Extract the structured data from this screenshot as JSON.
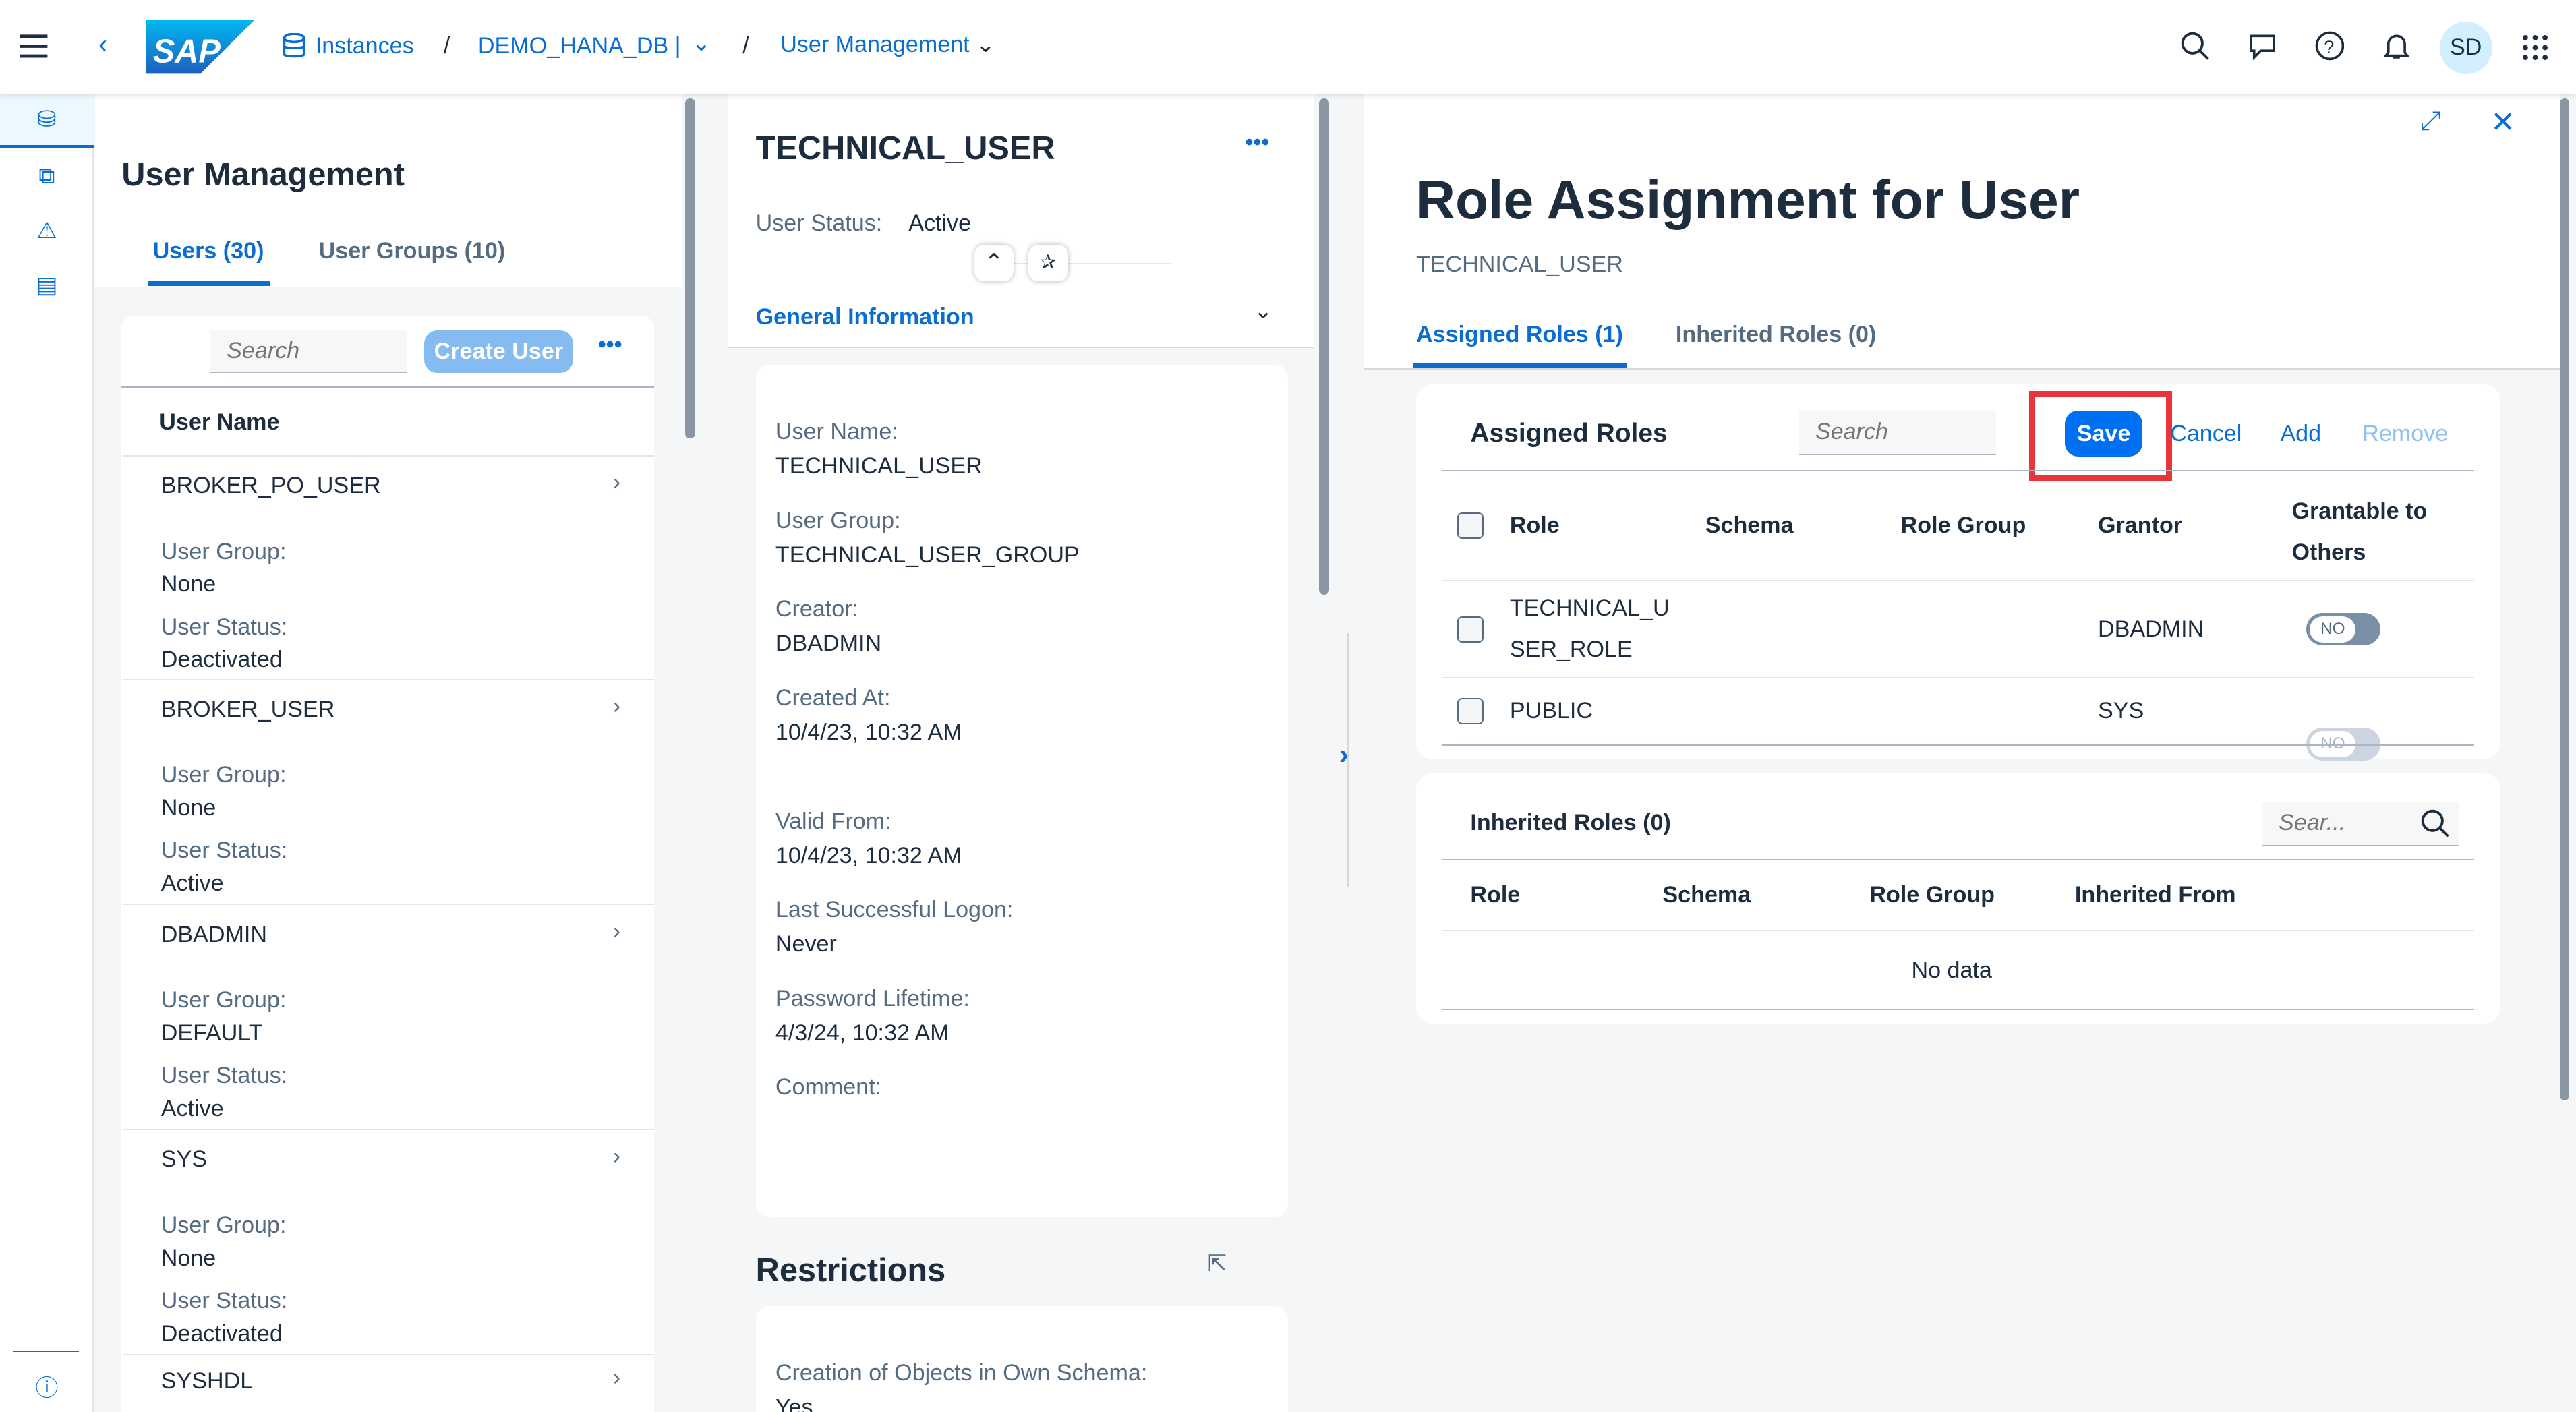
{
  "header": {
    "instances": "Instances",
    "sep": "/",
    "db": "DEMO_HANA_DB |",
    "page": "User Management",
    "avatar": "SD",
    "logo": "SAP"
  },
  "users_panel": {
    "title": "User Management",
    "tabs": [
      "Users (30)",
      "User Groups (10)"
    ],
    "search_placeholder": "Search",
    "create_user": "Create User",
    "column": "User Name",
    "group_label": "User Group:",
    "status_label": "User Status:",
    "users": [
      {
        "name": "BROKER_PO_USER",
        "group": "None",
        "status": "Deactivated"
      },
      {
        "name": "BROKER_USER",
        "group": "None",
        "status": "Active"
      },
      {
        "name": "DBADMIN",
        "group": "DEFAULT",
        "status": "Active"
      },
      {
        "name": "SYS",
        "group": "None",
        "status": "Deactivated"
      },
      {
        "name": "SYSHDL"
      }
    ]
  },
  "detail": {
    "title": "TECHNICAL_USER",
    "status_label": "User Status:",
    "status": "Active",
    "section": "General Information",
    "fields": [
      {
        "label": "User Name:",
        "value": "TECHNICAL_USER"
      },
      {
        "label": "User Group:",
        "value": "TECHNICAL_USER_GROUP"
      },
      {
        "label": "Creator:",
        "value": "DBADMIN"
      },
      {
        "label": "Created At:",
        "value": "10/4/23, 10:32 AM"
      },
      {
        "label": "Valid From:",
        "value": "10/4/23, 10:32 AM"
      },
      {
        "label": "Last Successful Logon:",
        "value": "Never"
      },
      {
        "label": "Password Lifetime:",
        "value": "4/3/24, 10:32 AM"
      },
      {
        "label": "Comment:",
        "value": ""
      }
    ],
    "restrictions_title": "Restrictions",
    "restriction_label": "Creation of Objects in Own Schema:",
    "restriction_value": "Yes"
  },
  "roles": {
    "title": "Role Assignment for User",
    "subtitle": "TECHNICAL_USER",
    "tabs": [
      "Assigned Roles (1)",
      "Inherited Roles (0)"
    ],
    "assigned": {
      "title": "Assigned Roles",
      "search_placeholder": "Search",
      "save": "Save",
      "cancel": "Cancel",
      "add": "Add",
      "remove": "Remove",
      "columns": [
        "Role",
        "Schema",
        "Role Group",
        "Grantor",
        "Grantable to Others"
      ],
      "rows": [
        {
          "role": "TECHNICAL_USER_ROLE",
          "role_l1": "TECHNICAL_U",
          "role_l2": "SER_ROLE",
          "grantor": "DBADMIN",
          "grantable": "NO"
        },
        {
          "role": "PUBLIC",
          "grantor": "SYS",
          "grantable": "NO"
        }
      ]
    },
    "inherited": {
      "title": "Inherited Roles (0)",
      "search_placeholder": "Sear...",
      "columns": [
        "Role",
        "Schema",
        "Role Group",
        "Inherited From"
      ],
      "empty": "No data"
    }
  }
}
